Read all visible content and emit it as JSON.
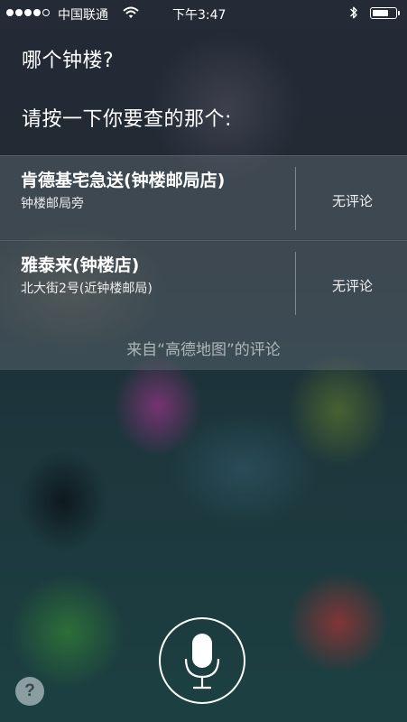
{
  "status_bar": {
    "signal_dots_filled": 4,
    "signal_dots_total": 5,
    "carrier": "中国联通",
    "time": "下午3:47",
    "battery_level_percent": 70,
    "icons": [
      "wifi-icon",
      "bluetooth-icon",
      "battery-icon"
    ]
  },
  "siri": {
    "question": "哪个钟楼?",
    "prompt": "请按一下你要查的那个:"
  },
  "results": [
    {
      "title": "肯德基宅急送(钟楼邮局店)",
      "address": "钟楼邮局旁",
      "review": "无评论"
    },
    {
      "title": "雅泰来(钟楼店)",
      "address": "北大街2号(近钟楼邮局)",
      "review": "无评论"
    }
  ],
  "source_note": "来自“高德地图”的评论",
  "mic": {
    "icon": "microphone-icon"
  },
  "help": {
    "label": "?"
  },
  "colors": {
    "text": "#ffffff",
    "panel": "#6e7880",
    "source_text": "#dce1e6"
  }
}
